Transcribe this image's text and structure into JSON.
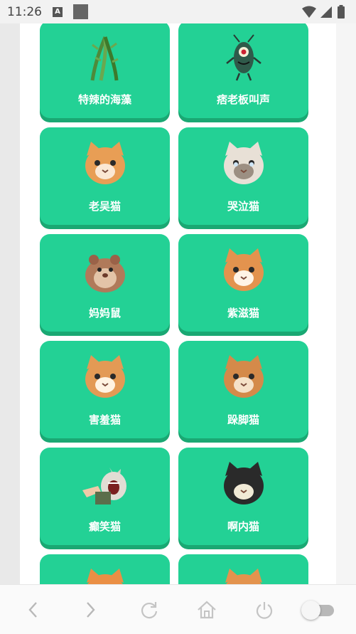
{
  "status_bar": {
    "time": "11:26",
    "a_icon_letter": "A"
  },
  "grid": {
    "items": [
      {
        "label": "特辣的海藻",
        "icon": "seaweed-icon"
      },
      {
        "label": "痞老板叫声",
        "icon": "plankton-icon"
      },
      {
        "label": "老吴猫",
        "icon": "cat-icon"
      },
      {
        "label": "哭泣猫",
        "icon": "crying-cat-icon"
      },
      {
        "label": "妈妈鼠",
        "icon": "hamster-icon"
      },
      {
        "label": "紫滋猫",
        "icon": "cat-icon"
      },
      {
        "label": "害羞猫",
        "icon": "cat-icon"
      },
      {
        "label": "跺脚猫",
        "icon": "cat-icon"
      },
      {
        "label": "癫笑猫",
        "icon": "laughing-cat-icon"
      },
      {
        "label": "啊内猫",
        "icon": "cat-icon"
      },
      {
        "label": "",
        "icon": "cat-icon"
      },
      {
        "label": "",
        "icon": "cat-icon"
      }
    ]
  },
  "nav": {
    "back": "back-arrow-icon",
    "forward": "forward-arrow-icon",
    "reload": "reload-icon",
    "home": "home-icon",
    "power": "power-icon",
    "toggle_state": "off"
  },
  "colors": {
    "card": "#23d195",
    "card_shadow": "#1aa873",
    "card_text": "#ffffff"
  }
}
